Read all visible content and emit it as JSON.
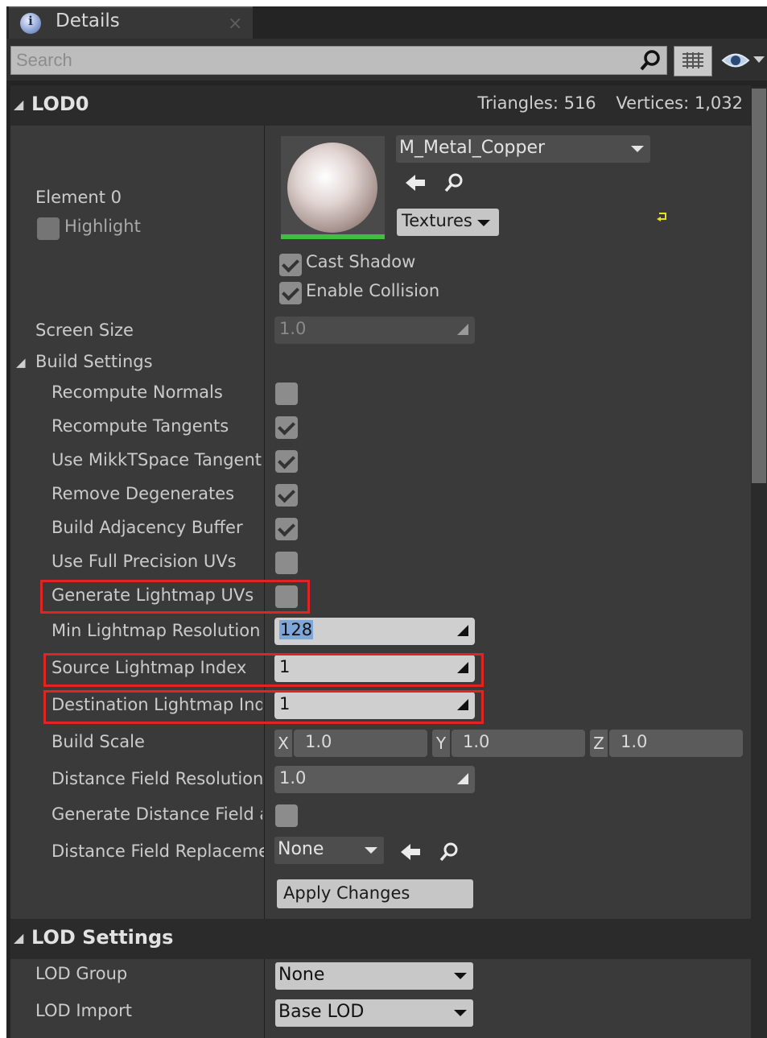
{
  "tab": {
    "title": "Details",
    "close": "×",
    "icon": "info-icon"
  },
  "search": {
    "placeholder": "Search",
    "value": ""
  },
  "lod0": {
    "header": "LOD0",
    "triangles": "Triangles: 516",
    "vertices": "Vertices: 1,032",
    "element_label": "Element 0",
    "highlight_label": "Highlight",
    "material_name": "M_Metal_Copper",
    "textures_label": "Textures",
    "cast_shadow_label": "Cast Shadow",
    "cast_shadow": true,
    "enable_collision_label": "Enable Collision",
    "enable_collision": true,
    "screen_size_label": "Screen Size",
    "screen_size_value": "1.0"
  },
  "build_settings": {
    "header": "Build Settings",
    "recompute_normals": {
      "label": "Recompute Normals",
      "checked": false
    },
    "recompute_tangents": {
      "label": "Recompute Tangents",
      "checked": true
    },
    "use_mikkt": {
      "label": "Use MikkTSpace Tangent",
      "checked": true
    },
    "remove_degenerates": {
      "label": "Remove Degenerates",
      "checked": true
    },
    "build_adjacency": {
      "label": "Build Adjacency Buffer",
      "checked": true
    },
    "full_precision_uvs": {
      "label": "Use Full Precision UVs",
      "checked": false
    },
    "generate_lightmap_uvs": {
      "label": "Generate Lightmap UVs",
      "checked": false
    },
    "min_lightmap_res": {
      "label": "Min Lightmap Resolution",
      "value": "128"
    },
    "source_lightmap_index": {
      "label": "Source Lightmap Index",
      "value": "1"
    },
    "dest_lightmap_index": {
      "label": "Destination Lightmap Inde:",
      "value": "1"
    },
    "build_scale": {
      "label": "Build Scale",
      "x_label": "X",
      "x": "1.0",
      "y_label": "Y",
      "y": "1.0",
      "z_label": "Z",
      "z": "1.0"
    },
    "distance_field_res": {
      "label": "Distance Field Resolution S",
      "value": "1.0"
    },
    "generate_df_as": {
      "label": "Generate Distance Field as",
      "checked": false
    },
    "df_replacement": {
      "label": "Distance Field Replacemen",
      "value": "None"
    },
    "apply_changes": "Apply Changes"
  },
  "lod_settings": {
    "header": "LOD Settings",
    "lod_group": {
      "label": "LOD Group",
      "value": "None"
    },
    "lod_import": {
      "label": "LOD Import",
      "value": "Base LOD"
    }
  },
  "colors": {
    "panel": "#3a3a3a",
    "header": "#2b2b2b",
    "highlight_red": "#e02424",
    "thumbnail_green": "#3fbf3f"
  }
}
